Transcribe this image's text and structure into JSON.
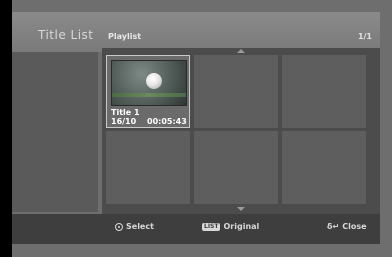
{
  "header": {
    "title": "Title List",
    "subtitle": "Playlist",
    "page": "1/1"
  },
  "grid": {
    "items": [
      {
        "label": "Title 1",
        "date": "16/10",
        "duration": "00:05:43"
      }
    ]
  },
  "footer": {
    "select_label": "Select",
    "original_badge": "LIST",
    "original_label": "Original",
    "close_symbol": "δ↵",
    "close_label": "Close"
  },
  "icons": {
    "select": "select-circle-icon",
    "scroll_up": "scroll-up-arrow-icon",
    "scroll_down": "scroll-down-arrow-icon"
  }
}
